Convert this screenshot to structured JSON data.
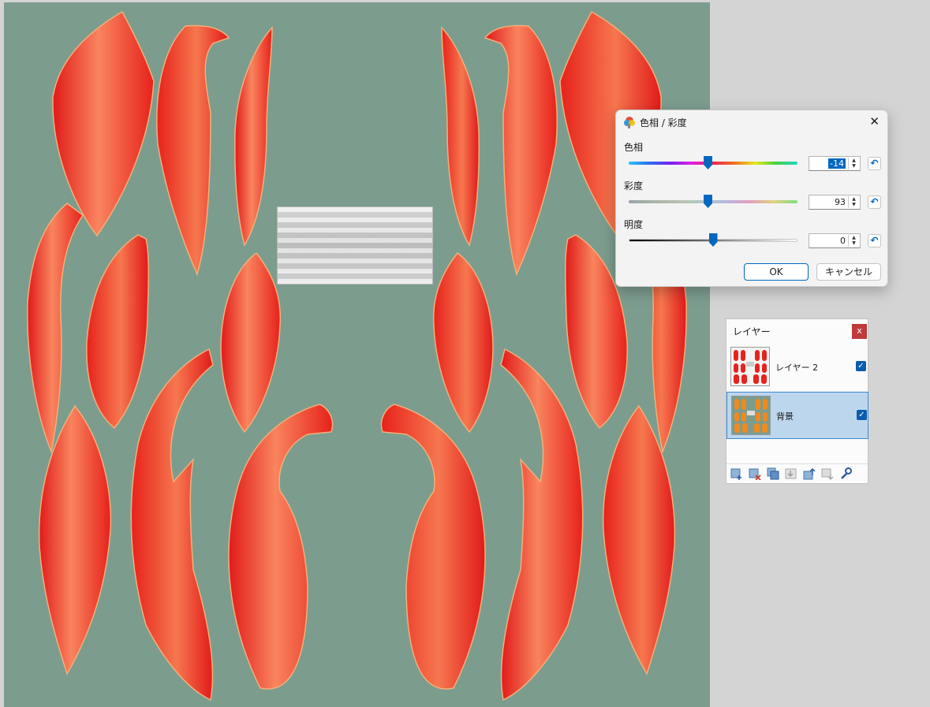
{
  "dialog": {
    "title": "色相 / 彩度",
    "close_glyph": "✕",
    "sliders": [
      {
        "label": "色相",
        "value": "-14",
        "fraction": 0.47
      },
      {
        "label": "彩度",
        "value": "93",
        "fraction": 0.47
      },
      {
        "label": "明度",
        "value": "0",
        "fraction": 0.5
      }
    ],
    "ok_label": "OK",
    "cancel_label": "キャンセル"
  },
  "layers_panel": {
    "title": "レイヤー",
    "close_glyph": "x",
    "layers": [
      {
        "name": "レイヤー 2",
        "visible": true,
        "selected": false
      },
      {
        "name": "背景",
        "visible": true,
        "selected": true
      }
    ],
    "tools": [
      "new-layer-icon",
      "delete-layer-icon",
      "duplicate-layer-icon",
      "merge-down-icon",
      "move-layer-up-icon",
      "move-layer-down-icon",
      "layer-properties-icon"
    ]
  },
  "colors": {
    "canvas_bg": "#7c9c8e",
    "petal_red": "#e8201c",
    "petal_light": "#f77a55",
    "accent": "#0067c0"
  }
}
